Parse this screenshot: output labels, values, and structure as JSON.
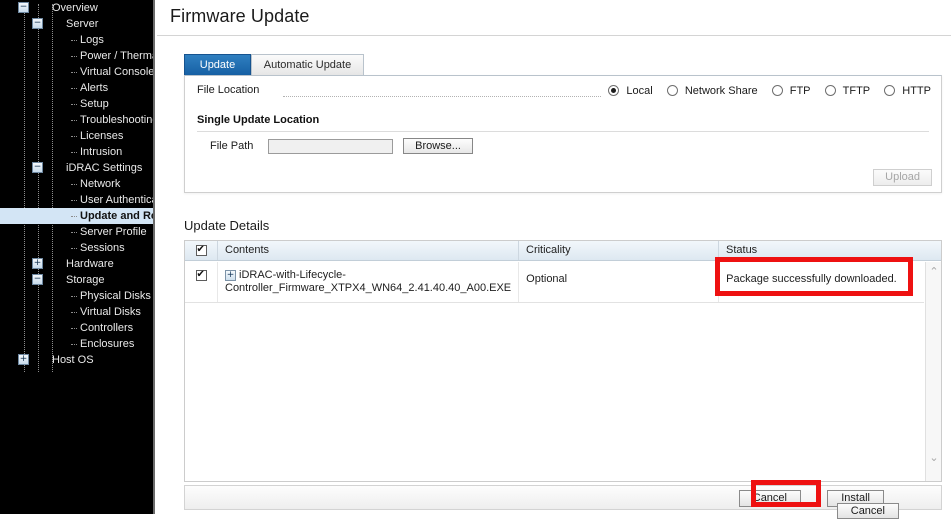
{
  "sidebar": {
    "items": [
      {
        "label": "Overview",
        "depth": 0,
        "toggle": "minus",
        "selected": false
      },
      {
        "label": "Server",
        "depth": 1,
        "toggle": "minus",
        "selected": false
      },
      {
        "label": "Logs",
        "depth": 2,
        "toggle": "",
        "selected": false
      },
      {
        "label": "Power / Thermal",
        "depth": 2,
        "toggle": "",
        "selected": false
      },
      {
        "label": "Virtual Console",
        "depth": 2,
        "toggle": "",
        "selected": false
      },
      {
        "label": "Alerts",
        "depth": 2,
        "toggle": "",
        "selected": false
      },
      {
        "label": "Setup",
        "depth": 2,
        "toggle": "",
        "selected": false
      },
      {
        "label": "Troubleshooting",
        "depth": 2,
        "toggle": "",
        "selected": false
      },
      {
        "label": "Licenses",
        "depth": 2,
        "toggle": "",
        "selected": false
      },
      {
        "label": "Intrusion",
        "depth": 2,
        "toggle": "",
        "selected": false
      },
      {
        "label": "iDRAC Settings",
        "depth": 1,
        "toggle": "minus",
        "selected": false
      },
      {
        "label": "Network",
        "depth": 2,
        "toggle": "",
        "selected": false
      },
      {
        "label": "User Authentication",
        "depth": 2,
        "toggle": "",
        "selected": false
      },
      {
        "label": "Update and Rollback",
        "depth": 2,
        "toggle": "",
        "selected": true
      },
      {
        "label": "Server Profile",
        "depth": 2,
        "toggle": "",
        "selected": false
      },
      {
        "label": "Sessions",
        "depth": 2,
        "toggle": "",
        "selected": false
      },
      {
        "label": "Hardware",
        "depth": 1,
        "toggle": "plus",
        "selected": false
      },
      {
        "label": "Storage",
        "depth": 1,
        "toggle": "minus",
        "selected": false
      },
      {
        "label": "Physical Disks",
        "depth": 2,
        "toggle": "",
        "selected": false
      },
      {
        "label": "Virtual Disks",
        "depth": 2,
        "toggle": "",
        "selected": false
      },
      {
        "label": "Controllers",
        "depth": 2,
        "toggle": "",
        "selected": false
      },
      {
        "label": "Enclosures",
        "depth": 2,
        "toggle": "",
        "selected": false
      },
      {
        "label": "Host OS",
        "depth": 0,
        "toggle": "plus",
        "selected": false
      }
    ]
  },
  "page": {
    "title": "Firmware Update"
  },
  "tabs": [
    {
      "label": "Update",
      "active": true
    },
    {
      "label": "Automatic Update",
      "active": false
    }
  ],
  "form": {
    "file_location_label": "File Location",
    "location_options": [
      {
        "label": "Local",
        "selected": true
      },
      {
        "label": "Network Share",
        "selected": false
      },
      {
        "label": "FTP",
        "selected": false
      },
      {
        "label": "TFTP",
        "selected": false
      },
      {
        "label": "HTTP",
        "selected": false
      }
    ],
    "single_update_location_label": "Single Update Location",
    "file_path_label": "File Path",
    "file_path_value": "",
    "file_path_placeholder": "",
    "browse_label": "Browse...",
    "upload_label": "Upload"
  },
  "update_details": {
    "title": "Update Details",
    "columns": [
      "",
      "Contents",
      "Criticality",
      "Status"
    ],
    "header_select_all_checked": true,
    "rows": [
      {
        "checked": true,
        "expand_icon": "+",
        "contents": "iDRAC-with-Lifecycle-Controller_Firmware_XTPX4_WN64_2.41.40.40_A00.EXE",
        "criticality": "Optional",
        "status": "Package successfully downloaded."
      }
    ]
  },
  "footer": {
    "cancel_label": "Cancel",
    "install_label": "Install",
    "overlap_cancel_label": "Cancel"
  },
  "scrollbar": {
    "up_arrow": "⌃",
    "down_arrow": "⌄"
  },
  "annotations": {
    "accent_color": "#ee1111"
  }
}
